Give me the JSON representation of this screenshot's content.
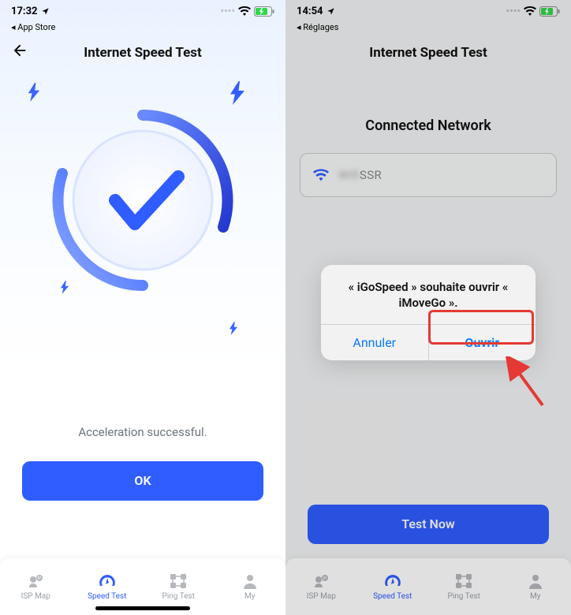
{
  "left": {
    "status": {
      "time": "17:32",
      "breadcrumb": "App Store"
    },
    "header": {
      "title": "Internet Speed Test"
    },
    "result_text": "Acceleration successful.",
    "primary_button": "OK"
  },
  "right": {
    "status": {
      "time": "14:54",
      "breadcrumb": "Réglages"
    },
    "header": {
      "title": "Internet Speed Test"
    },
    "section_title": "Connected Network",
    "network_name": "SSR",
    "alert": {
      "title": "« iGoSpeed » souhaite ouvrir « iMoveGo ».",
      "cancel": "Annuler",
      "open": "Ouvrir"
    },
    "primary_button": "Test Now"
  },
  "tabs": [
    {
      "label": "ISP Map",
      "active": false
    },
    {
      "label": "Speed Test",
      "active": true
    },
    {
      "label": "Ping Test",
      "active": false
    },
    {
      "label": "My",
      "active": false
    }
  ]
}
